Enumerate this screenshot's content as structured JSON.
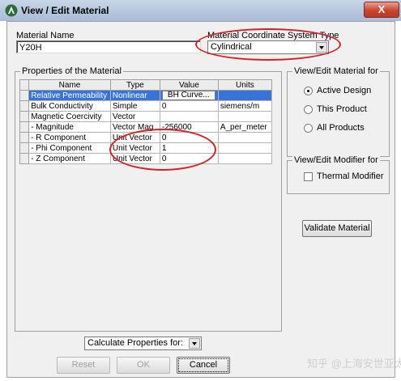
{
  "window": {
    "title": "View / Edit Material",
    "close_label": "X"
  },
  "material_name": {
    "label": "Material Name",
    "value": "Y20H"
  },
  "coordinate_system": {
    "label": "Material Coordinate System Type",
    "value": "Cylindrical"
  },
  "properties": {
    "group_title": "Properties of the Material",
    "headers": [
      "Name",
      "Type",
      "Value",
      "Units"
    ],
    "rows": [
      {
        "name": "Relative Permeability",
        "type": "Nonlinear",
        "value": "BH Curve...",
        "units": ""
      },
      {
        "name": "Bulk Conductivity",
        "type": "Simple",
        "value": "0",
        "units": "siemens/m"
      },
      {
        "name": "Magnetic Coercivity",
        "type": "Vector",
        "value": "",
        "units": ""
      },
      {
        "name": "- Magnitude",
        "type": "Vector Mag",
        "value": "-256000",
        "units": "A_per_meter"
      },
      {
        "name": "- R Component",
        "type": "Unit Vector",
        "value": "0",
        "units": ""
      },
      {
        "name": "- Phi Component",
        "type": "Unit Vector",
        "value": "1",
        "units": ""
      },
      {
        "name": "- Z Component",
        "type": "Unit Vector",
        "value": "0",
        "units": ""
      }
    ]
  },
  "view_edit_for": {
    "title": "View/Edit Material for",
    "options": [
      {
        "label": "Active Design",
        "selected": true
      },
      {
        "label": "This Product",
        "selected": false
      },
      {
        "label": "All Products",
        "selected": false
      }
    ]
  },
  "modifier": {
    "title": "View/Edit Modifier for",
    "thermal_label": "Thermal Modifier",
    "thermal_checked": false
  },
  "validate_label": "Validate Material",
  "calculate": {
    "value": "Calculate Properties for:"
  },
  "buttons": {
    "reset": "Reset",
    "ok": "OK",
    "cancel": "Cancel"
  },
  "watermark": "知乎 @上海安世亚太",
  "colors": {
    "selection": "#3a73d6",
    "annotation": "#d2232a",
    "titlebar": "#b4c6dd"
  }
}
